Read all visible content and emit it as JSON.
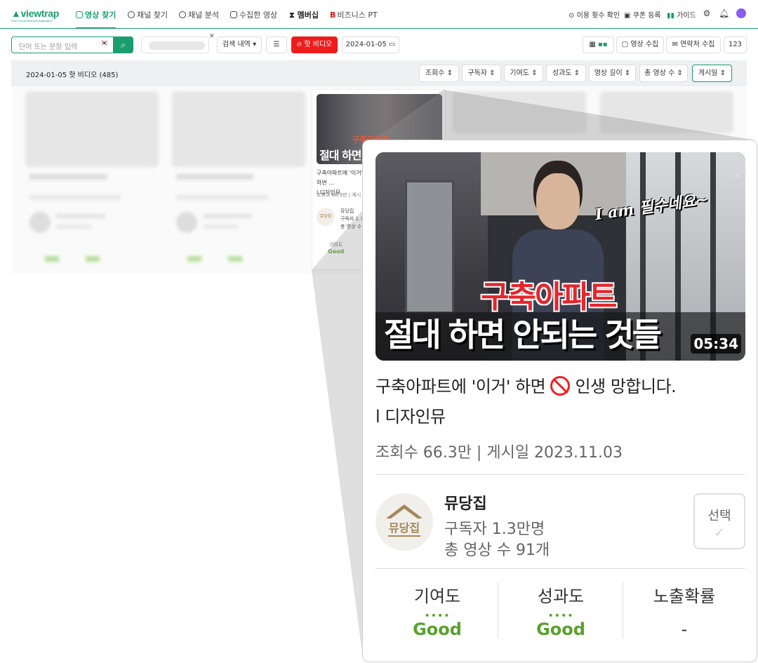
{
  "brand": {
    "logo": "viewtrap",
    "tagline": "View Trend Research Application",
    "accent": "#1a9e6e"
  },
  "nav": {
    "items": [
      {
        "label": "영상 찾기",
        "icon": "video-search-icon"
      },
      {
        "label": "채널 찾기",
        "icon": "channel-search-icon"
      },
      {
        "label": "채널 분석",
        "icon": "channel-analysis-icon"
      },
      {
        "label": "수집한 영상",
        "icon": "folder-icon"
      },
      {
        "label": "멤버십",
        "icon": "hourglass-icon"
      },
      {
        "label": "비즈니스 PT",
        "icon": "business-icon"
      }
    ],
    "right": {
      "usage": "이용 횟수 확인",
      "coupon": "쿠폰 등록",
      "guide": "가이드"
    }
  },
  "toolbar": {
    "search_placeholder": "단어 또는 문장 입력",
    "history": "검색 내역 ▾",
    "hot": "핫 비디오",
    "date": "2024-01-05",
    "collect_video": "영상 수집",
    "collect_contact": "연락처 수집",
    "count": "123"
  },
  "results": {
    "title": "2024-01-05 핫 비디오 (485)",
    "sorts": [
      "조회수",
      "구독자",
      "기여도",
      "성과도",
      "영상 길이",
      "총 영상 수",
      "게시일"
    ]
  },
  "card": {
    "thumb_text_en": "I am 필수네요~",
    "thumb_text_red": "구축아파트",
    "thumb_text_white": "절대 하면 안되는 것들",
    "duration": "05:34",
    "title_part1": "구축아파트에 '이거' 하면",
    "title_part2": "인생 망합니다.",
    "title_line2": "l 디자인뮤",
    "meta": "조회수 66.3만 | 게시일 2023.11.03",
    "channel": {
      "name": "뮤당집",
      "logo_text": "뮤당집",
      "subscribers": "구독자 1.3만명",
      "videos": "총 영상 수 91개"
    },
    "select": "선택",
    "stats": [
      {
        "label": "기여도",
        "value": "Good"
      },
      {
        "label": "성과도",
        "value": "Good"
      },
      {
        "label": "노출확률",
        "value": "-"
      }
    ]
  },
  "small_card": {
    "thumb_red": "구축아파트",
    "thumb_white": "절대 하면",
    "title": "구축아파트에 '이거' 하면 ...",
    "title2": "l 디자인뮤",
    "meta": "조회수 66.3만 | 게시",
    "channel": "뮤당집",
    "channel_sub": "구독자 1.3",
    "channel_vid": "총 영상 수",
    "stat_label": "기여도",
    "stat_val": "Good"
  }
}
